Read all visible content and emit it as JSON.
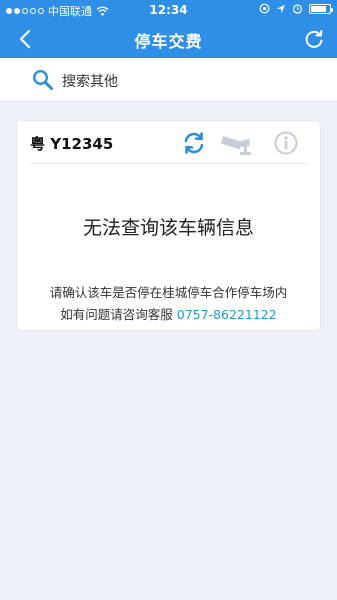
{
  "status_bar": {
    "carrier": "中国联通",
    "time": "12:34",
    "battery_level": 0.85,
    "icons": [
      "signal-dots-icon",
      "wifi-icon",
      "orientation-lock-icon",
      "location-arrow-icon",
      "alarm-icon",
      "battery-icon"
    ]
  },
  "navbar": {
    "title": "停车交费",
    "back_icon": "chevron-left-icon",
    "refresh_icon": "refresh-icon"
  },
  "search": {
    "label": "搜索其他",
    "icon": "search-icon"
  },
  "card": {
    "plate": "粤 Y12345",
    "icons": [
      "sync-icon",
      "camera-icon",
      "info-icon"
    ],
    "message": "无法查询该车辆信息",
    "sub_message": "请确认该车是否停在桂城停车合作停车场内",
    "help_prefix": "如有问题请咨询客服",
    "phone": "0757-86221122"
  },
  "colors": {
    "primary": "#2f8fe6",
    "background": "#eef1f7",
    "link": "#1e9bd6",
    "icon_blue": "#2a8fd8",
    "icon_gray": "#c7ccd6"
  }
}
